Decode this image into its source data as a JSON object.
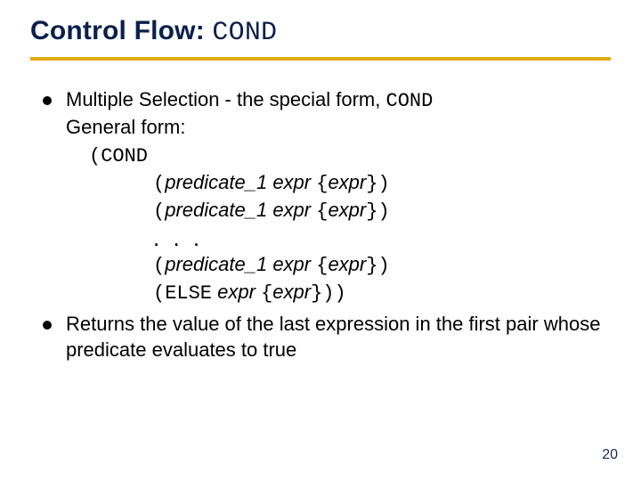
{
  "title": {
    "prefix": "Control Flow: ",
    "code": "COND"
  },
  "bullets": {
    "b1": {
      "pre": "Multiple Selection - the special form, ",
      "code": "COND",
      "line2": "General form:"
    },
    "b2": {
      "text": "Returns the value of the last expression in the first pair whose predicate evaluates to true"
    }
  },
  "code": {
    "open": "(COND",
    "row1": {
      "a": "(",
      "pred": "predicate_1",
      "sp1": "  ",
      "e1": "expr",
      "sp2": "  ",
      "lb": "{",
      "e2": "expr",
      "rb": "}",
      "close": ")"
    },
    "row2": {
      "a": "(",
      "pred": "predicate_1",
      "sp1": "  ",
      "e1": "expr",
      "sp2": "  ",
      "lb": "{",
      "e2": "expr",
      "rb": "}",
      "close": ")"
    },
    "dots": ". . .",
    "row3": {
      "a": "(",
      "pred": "predicate_1",
      "sp1": "  ",
      "e1": "expr",
      "sp2": "  ",
      "lb": "{",
      "e2": "expr",
      "rb": "}",
      "close": ")"
    },
    "row4": {
      "a": "(",
      "else": "ELSE",
      "sp1": "  ",
      "e1": "expr",
      "sp2": "  ",
      "lb": "{",
      "e2": "expr",
      "rb": "}",
      "close": "))"
    }
  },
  "page_number": "20"
}
